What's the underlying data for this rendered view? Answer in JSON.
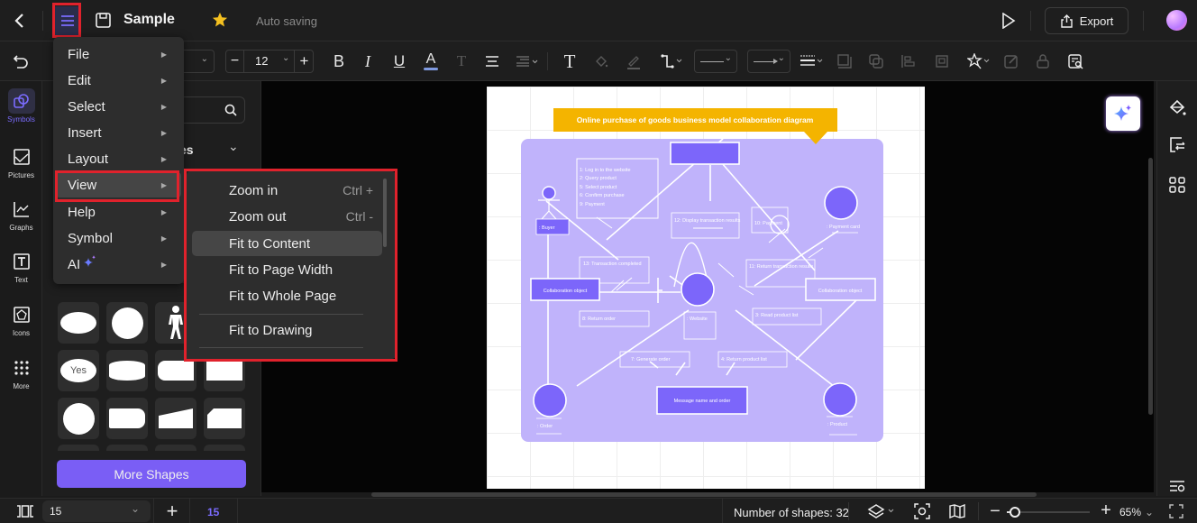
{
  "header": {
    "title": "Sample",
    "status": "Auto saving",
    "export_label": "Export"
  },
  "toolbar": {
    "font_size": "12"
  },
  "rail": {
    "items": [
      {
        "label": "Symbols",
        "icon": "symbols-icon"
      },
      {
        "label": "Pictures",
        "icon": "pictures-icon"
      },
      {
        "label": "Graphs",
        "icon": "graphs-icon"
      },
      {
        "label": "Text",
        "icon": "text-icon"
      },
      {
        "label": "Icons",
        "icon": "icons-icon"
      },
      {
        "label": "More",
        "icon": "more-icon"
      }
    ]
  },
  "library": {
    "section_partial": "es",
    "tile_yes": "Yes",
    "more_shapes": "More Shapes"
  },
  "main_menu": {
    "items": [
      {
        "label": "File"
      },
      {
        "label": "Edit"
      },
      {
        "label": "Select"
      },
      {
        "label": "Insert"
      },
      {
        "label": "Layout"
      },
      {
        "label": "View"
      },
      {
        "label": "Help"
      },
      {
        "label": "Symbol"
      },
      {
        "label": "AI"
      }
    ],
    "active": "View"
  },
  "view_submenu": {
    "items": [
      {
        "label": "Zoom in",
        "shortcut": "Ctrl +"
      },
      {
        "label": "Zoom out",
        "shortcut": "Ctrl -"
      },
      {
        "label": "Fit to Content",
        "shortcut": ""
      },
      {
        "label": "Fit to Page Width",
        "shortcut": ""
      },
      {
        "label": "Fit to Whole Page",
        "shortcut": ""
      },
      {
        "label": "Fit to Drawing",
        "shortcut": ""
      }
    ],
    "highlighted": "Fit to Content"
  },
  "diagram": {
    "title": "Online purchase of goods business model collaboration diagram",
    "messages_box": [
      "1: Log in to the website",
      "2: Query product",
      "5: Select product",
      "6: Confirm purchase",
      "9: Payment"
    ],
    "display_results": "12: Display transaction results",
    "payment": "10: Payment",
    "buyer": ": Buyer",
    "payment_card": ": Payment card",
    "transaction_completed": "13: Transaction completed",
    "return_results": "11: Return transaction results",
    "collab_left": "Collaboration object",
    "collab_right": "Collaboration object",
    "website": ": Website",
    "return_order": "8: Return order",
    "read_product_list": "3: Read product list",
    "generate_order": "7: Generate order",
    "return_product_list": "4: Return product list",
    "message_name": "Message name and order",
    "order": ": Order",
    "product": ": Product"
  },
  "status": {
    "page_select": "15",
    "page_num": "15",
    "shape_count": "Number of shapes: 32",
    "zoom_value": "65%",
    "zoom_level_fraction": 0.1
  },
  "colors": {
    "accent": "#7a5ef5",
    "highlight_red": "#e0222c",
    "diagram_bg": "#c0b3fb",
    "diagram_title_bg": "#f4b400"
  }
}
